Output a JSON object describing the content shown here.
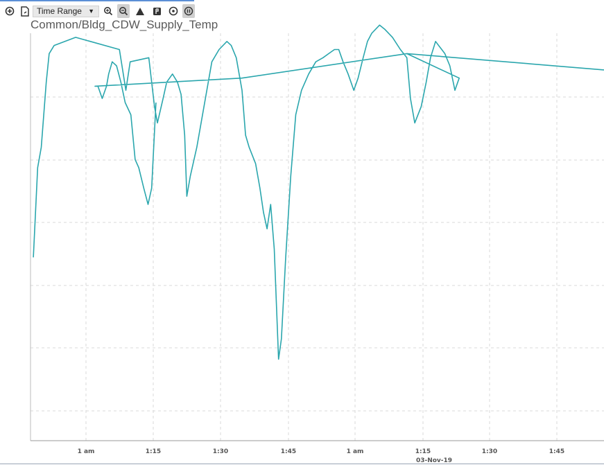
{
  "toolbar": {
    "icons": [
      "add-icon",
      "export-icon",
      "zoom-in-icon",
      "zoom-active-icon",
      "alert-icon",
      "flag-icon",
      "target-icon",
      "pause-icon"
    ],
    "time_range_label": "Time Range",
    "time_range_caret": "▼"
  },
  "chart_data": {
    "type": "line",
    "title": "Common/Bldg_CDW_Supply_Temp",
    "xlabel": "",
    "ylabel": "",
    "grid": true,
    "line_color": "#2aa6ad",
    "x_ticks": [
      "1 am",
      "1:15",
      "1:30",
      "1:45",
      "1 am",
      "1:15",
      "1:30",
      "1:45"
    ],
    "x_date_label": "03-Nov-19",
    "ylim": [
      0,
      100
    ],
    "series": [
      {
        "name": "",
        "points": [
          [
            0.4,
            45
          ],
          [
            1.0,
            67
          ],
          [
            1.5,
            72
          ],
          [
            2.2,
            88
          ],
          [
            2.6,
            95
          ],
          [
            3.3,
            97
          ],
          [
            6.3,
            99
          ],
          [
            12.4,
            96
          ],
          [
            13.3,
            86
          ],
          [
            13.9,
            93
          ],
          [
            16.5,
            94
          ],
          [
            17.3,
            82
          ],
          [
            17.7,
            78
          ],
          [
            18.5,
            84
          ],
          [
            19.0,
            88
          ],
          [
            19.8,
            90
          ],
          [
            20.5,
            88
          ],
          [
            21.0,
            85
          ],
          [
            21.5,
            75
          ],
          [
            21.8,
            60
          ],
          [
            22.3,
            65
          ],
          [
            23.2,
            72
          ],
          [
            25.3,
            93
          ],
          [
            26.3,
            96
          ],
          [
            27.4,
            98
          ],
          [
            28.0,
            97
          ],
          [
            28.7,
            94
          ],
          [
            29.5,
            86
          ],
          [
            30.0,
            75
          ],
          [
            30.5,
            72
          ],
          [
            31.4,
            68
          ],
          [
            32.0,
            62
          ],
          [
            32.5,
            56
          ],
          [
            33.0,
            52
          ],
          [
            33.5,
            58
          ],
          [
            34.0,
            47
          ],
          [
            34.6,
            20
          ],
          [
            35.0,
            25
          ],
          [
            35.6,
            45
          ],
          [
            36.3,
            65
          ],
          [
            37.0,
            80
          ],
          [
            37.8,
            86
          ],
          [
            38.8,
            90
          ],
          [
            39.8,
            93
          ],
          [
            40.8,
            94
          ],
          [
            41.6,
            95
          ],
          [
            42.4,
            96
          ],
          [
            43.0,
            96
          ],
          [
            43.6,
            93
          ],
          [
            44.3,
            90
          ],
          [
            45.1,
            86
          ],
          [
            45.7,
            89
          ],
          [
            46.4,
            94
          ],
          [
            47.0,
            98
          ],
          [
            47.6,
            100
          ],
          [
            48.7,
            102
          ],
          [
            49.4,
            101
          ],
          [
            50.5,
            99
          ],
          [
            51.6,
            96
          ],
          [
            52.5,
            94
          ],
          [
            53.0,
            84
          ],
          [
            53.6,
            78
          ],
          [
            54.5,
            82
          ],
          [
            55.2,
            88
          ],
          [
            55.8,
            94
          ],
          [
            56.5,
            98
          ],
          [
            57.8,
            95
          ],
          [
            58.5,
            92
          ],
          [
            59.2,
            86
          ],
          [
            59.8,
            89
          ],
          [
            52.5,
            95
          ],
          [
            29.5,
            89
          ],
          [
            9.0,
            87
          ],
          [
            9.4,
            87
          ],
          [
            10.0,
            84
          ],
          [
            10.6,
            87
          ],
          [
            10.9,
            90
          ],
          [
            11.4,
            93
          ],
          [
            12.0,
            92
          ],
          [
            12.6,
            88
          ],
          [
            13.2,
            83
          ],
          [
            14.0,
            80
          ],
          [
            14.6,
            69
          ],
          [
            15.1,
            67
          ],
          [
            15.8,
            62
          ],
          [
            16.4,
            58
          ],
          [
            16.9,
            62
          ],
          [
            17.5,
            83
          ]
        ]
      }
    ]
  }
}
